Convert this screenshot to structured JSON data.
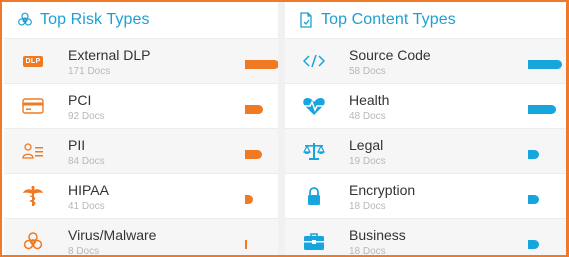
{
  "colors": {
    "accent_blue": "#1ea0d2",
    "risk_orange": "#f07a22",
    "content_blue": "#17a5dd",
    "frame_orange": "#ee7a2a"
  },
  "risk_panel": {
    "title": "Top Risk Types",
    "icon": "biohazard-icon",
    "items": [
      {
        "label": "External DLP",
        "docs": "171 Docs",
        "icon": "dlp-badge-icon",
        "icon_text": "DLP",
        "count": 171
      },
      {
        "label": "PCI",
        "docs": "92 Docs",
        "icon": "credit-card-icon",
        "count": 92
      },
      {
        "label": "PII",
        "docs": "84 Docs",
        "icon": "person-id-icon",
        "count": 84
      },
      {
        "label": "HIPAA",
        "docs": "41 Docs",
        "icon": "caduceus-icon",
        "count": 41
      },
      {
        "label": "Virus/Malware",
        "docs": "8 Docs",
        "icon": "biohazard-icon",
        "count": 8
      }
    ]
  },
  "content_panel": {
    "title": "Top Content Types",
    "icon": "document-icon",
    "items": [
      {
        "label": "Source Code",
        "docs": "58 Docs",
        "icon": "code-icon",
        "count": 58
      },
      {
        "label": "Health",
        "docs": "48 Docs",
        "icon": "heart-pulse-icon",
        "count": 48
      },
      {
        "label": "Legal",
        "docs": "19 Docs",
        "icon": "scales-icon",
        "count": 19
      },
      {
        "label": "Encryption",
        "docs": "18 Docs",
        "icon": "lock-icon",
        "count": 18
      },
      {
        "label": "Business",
        "docs": "18 Docs",
        "icon": "briefcase-icon",
        "count": 18
      }
    ]
  }
}
